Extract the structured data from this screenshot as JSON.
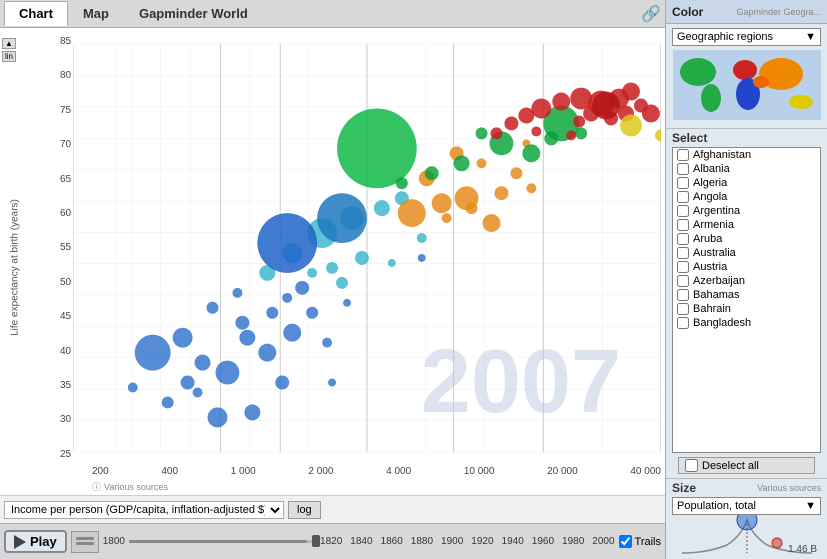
{
  "tabs": [
    {
      "label": "Chart",
      "active": true
    },
    {
      "label": "Map",
      "active": false
    },
    {
      "label": "Gapminder World",
      "active": false
    }
  ],
  "chart": {
    "year_watermark": "2007",
    "y_axis_label": "Life expectancy at birth (years)",
    "x_axis_label": "Income per person (GDP/capita, inflation-adjusted $)",
    "x_axis_select_value": "Income per person (GDP/capita, inflation-adjusted $)",
    "log_label": "log",
    "y_labels": [
      "85",
      "80",
      "75",
      "70",
      "65",
      "60",
      "55",
      "50",
      "45",
      "40",
      "35",
      "30",
      "25"
    ],
    "x_labels": [
      "200",
      "400",
      "1 000",
      "2 000",
      "4 000",
      "10 000",
      "20 000",
      "40 000"
    ],
    "sources": "Various sources"
  },
  "playbar": {
    "play_label": "Play",
    "timeline_years": [
      "1800",
      "1820",
      "1840",
      "1860",
      "1880",
      "1900",
      "1920",
      "1940",
      "1960",
      "1980",
      "2000"
    ],
    "trails_label": "Trails",
    "current_year": "2007"
  },
  "right_panel": {
    "title": "Color",
    "gapminder_label": "Gapminder Geogra...",
    "color_dropdown_label": "Geographic regions",
    "select_label": "Select",
    "countries": [
      "Afghanistan",
      "Albania",
      "Algeria",
      "Angola",
      "Argentina",
      "Armenia",
      "Aruba",
      "Australia",
      "Austria",
      "Azerbaijan",
      "Bahamas",
      "Bahrain",
      "Bangladesh"
    ],
    "deselect_all_label": "Deselect all",
    "size_label": "Size",
    "size_sources": "Various sources",
    "size_dropdown_label": "Population, total",
    "size_value": "1.46 B"
  }
}
